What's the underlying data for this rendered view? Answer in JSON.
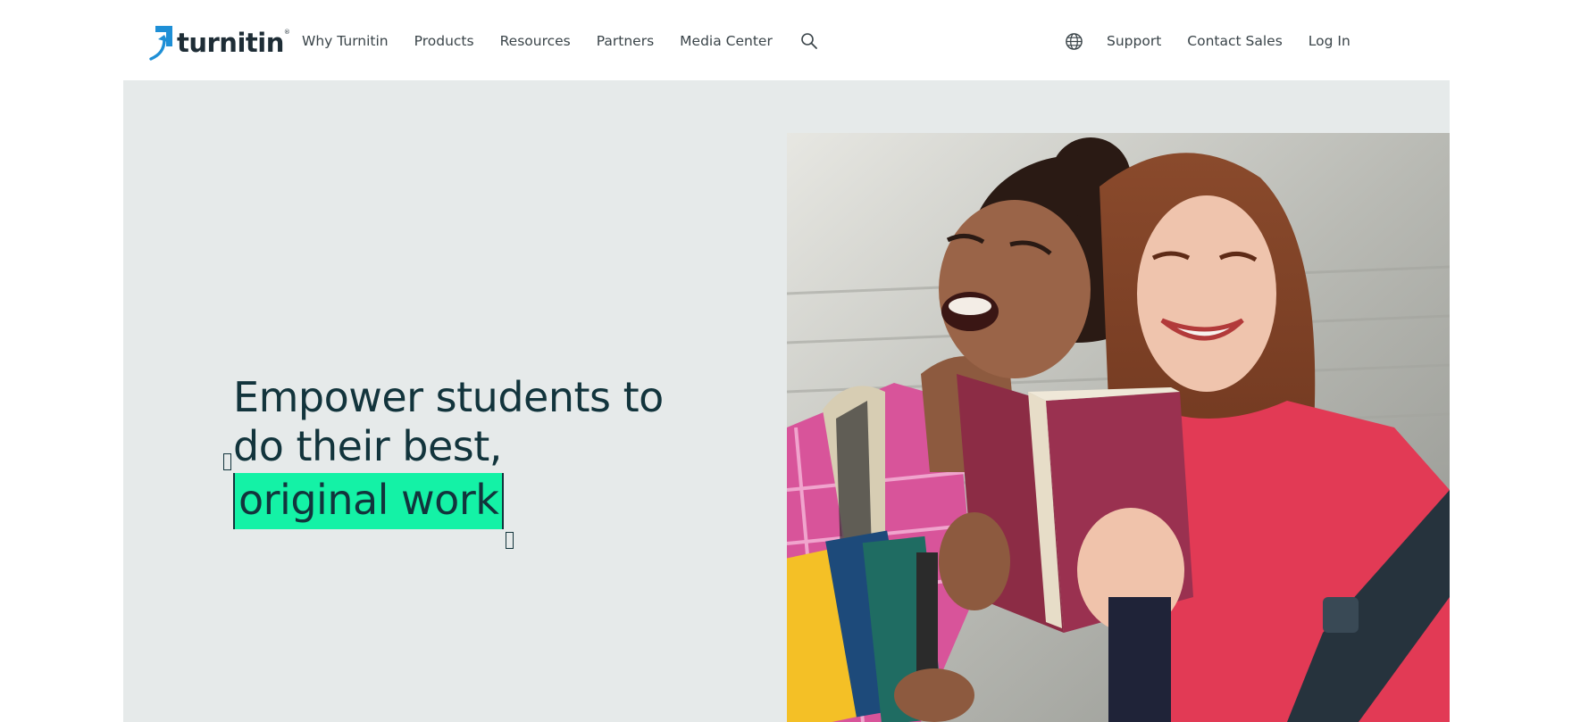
{
  "brand": {
    "name": "turnitin",
    "trademark": "®",
    "mark_color": "#1e8fd6"
  },
  "nav": {
    "primary": [
      {
        "label": "Why Turnitin"
      },
      {
        "label": "Products"
      },
      {
        "label": "Resources"
      },
      {
        "label": "Partners"
      },
      {
        "label": "Media Center"
      }
    ],
    "search_icon": "search-icon",
    "language_icon": "globe-icon",
    "secondary": [
      {
        "label": "Support"
      },
      {
        "label": "Contact Sales"
      },
      {
        "label": "Log In"
      }
    ]
  },
  "hero": {
    "background_color": "#e6eaea",
    "headline_line1": "Empower students to",
    "headline_line2": "do their best,",
    "headline_highlight": "original work",
    "highlight_color": "#14f2a6",
    "text_color": "#12343c",
    "photo_subject": "two-students-laughing-with-books"
  }
}
